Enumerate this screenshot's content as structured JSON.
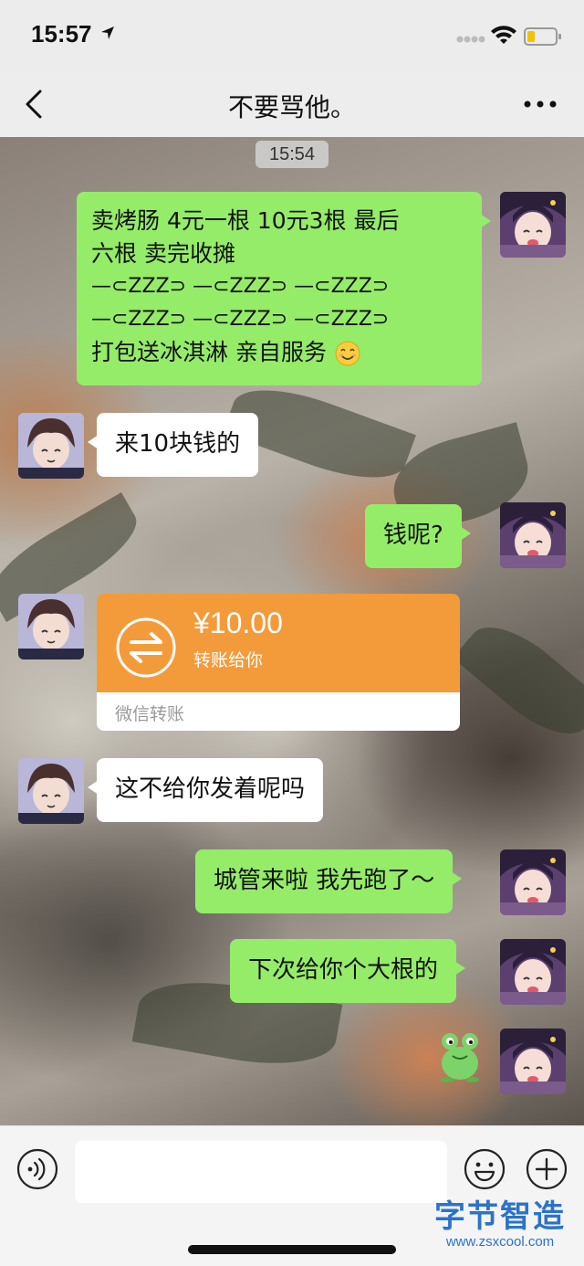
{
  "status_bar": {
    "time": "15:57"
  },
  "nav": {
    "title": "不要骂他。"
  },
  "chat": {
    "timestamp": "15:54",
    "messages": [
      {
        "side": "right",
        "lines": [
          "卖烤肠  4元一根 10元3根 最后",
          "六根  卖完收摊",
          "—⊂ZZZ⊃  —⊂ZZZ⊃ —⊂ZZZ⊃",
          " —⊂ZZZ⊃ —⊂ZZZ⊃ —⊂ZZZ⊃",
          " 打包送冰淇淋 亲自服务"
        ],
        "emoji": "smile-emoji"
      },
      {
        "side": "left",
        "text": "来10块钱的"
      },
      {
        "side": "right",
        "text": "钱呢?"
      },
      {
        "side": "left",
        "type": "transfer",
        "amount": "¥10.00",
        "desc": "转账给你",
        "label": "微信转账"
      },
      {
        "side": "left",
        "text": "这不给你发着呢吗"
      },
      {
        "side": "right",
        "text": "城管来啦 我先跑了～"
      },
      {
        "side": "right",
        "text": "下次给你个大根的"
      },
      {
        "side": "right",
        "type": "sticker",
        "sticker": "frog-sticker"
      }
    ]
  },
  "input_bar": {
    "text_value": ""
  },
  "watermark": {
    "logo": "字节智造",
    "url": "www.zsxcool.com"
  },
  "colors": {
    "bubble_green": "#95ec69",
    "bubble_white": "#ffffff",
    "transfer_orange": "#f39b3a",
    "watermark_blue": "#2b73c9"
  }
}
